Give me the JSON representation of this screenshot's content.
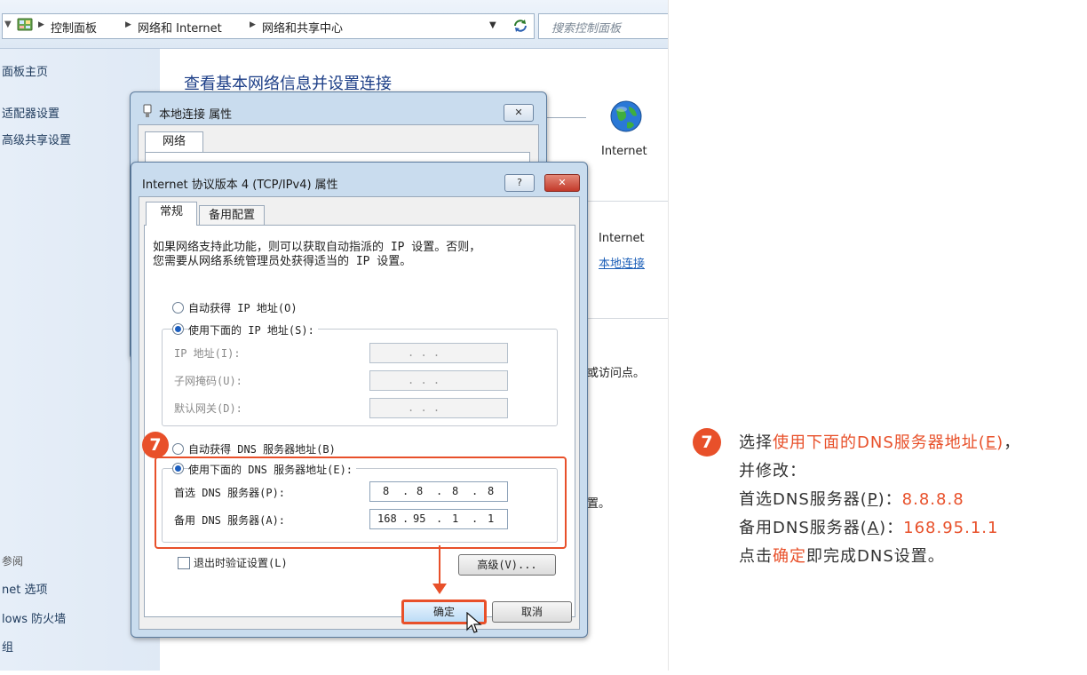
{
  "window": {
    "breadcrumb": [
      "控制面板",
      "网络和 Internet",
      "网络和共享中心"
    ],
    "search_placeholder": "搜索控制面板"
  },
  "left_pane": {
    "items": [
      "面板主页",
      "适配器设置",
      "高级共享设置"
    ],
    "see_also_title": "参阅",
    "see_also": [
      "net 选项",
      "lows 防火墙",
      "组"
    ]
  },
  "main": {
    "title": "查看基本网络信息并设置连接",
    "internet_label": "Internet",
    "access_type": "Internet",
    "connection_link": "本地连接",
    "text_fragment_1": "或访问点。",
    "text_fragment_2": "置。"
  },
  "dialog_local": {
    "title": "本地连接 属性",
    "tab": "网络",
    "close_label": "✕"
  },
  "dialog_ipv4": {
    "title": "Internet 协议版本 4 (TCP/IPv4) 属性",
    "help_label": "?",
    "close_label": "✕",
    "tabs": [
      "常规",
      "备用配置"
    ],
    "description_line1": "如果网络支持此功能，则可以获取自动指派的 IP 设置。否则，",
    "description_line2": "您需要从网络系统管理员处获得适当的 IP 设置。",
    "auto_ip": "自动获得 IP 地址(O)",
    "manual_ip": "使用下面的 IP 地址(S):",
    "ip_address_label": "IP 地址(I):",
    "subnet_label": "子网掩码(U):",
    "gateway_label": "默认网关(D):",
    "empty_ip": ".    .    .",
    "auto_dns": "自动获得 DNS 服务器地址(B)",
    "manual_dns": "使用下面的 DNS 服务器地址(E):",
    "preferred_dns_label": "首选 DNS 服务器(P):",
    "alternate_dns_label": "备用 DNS 服务器(A):",
    "preferred_dns": [
      "8",
      "8",
      "8",
      "8"
    ],
    "alternate_dns": [
      "168",
      "95",
      "1",
      "1"
    ],
    "validate_label": "退出时验证设置(L)",
    "advanced_label": "高级(V)...",
    "ok_label": "确定",
    "cancel_label": "取消",
    "selected_option": "manual_dns"
  },
  "instruction": {
    "step": "7",
    "line1_prefix": "选择",
    "line1_highlight": "使用下面的DNS服务器地址(",
    "line1_key": "E",
    "line1_close": ")",
    "line1_suffix": "，",
    "line2": "并修改：",
    "line3_prefix": "首选DNS服务器(",
    "line3_key": "P",
    "line3_close": ")：",
    "line3_value": "8.8.8.8",
    "line4_prefix": "备用DNS服务器(",
    "line4_key": "A",
    "line4_close": ")：",
    "line4_value": "168.95.1.1",
    "line5_prefix": "点击",
    "line5_highlight": "确定",
    "line5_suffix": "即完成DNS设置。"
  },
  "colors": {
    "accent": "#e8502a",
    "link": "#1c3e87"
  }
}
